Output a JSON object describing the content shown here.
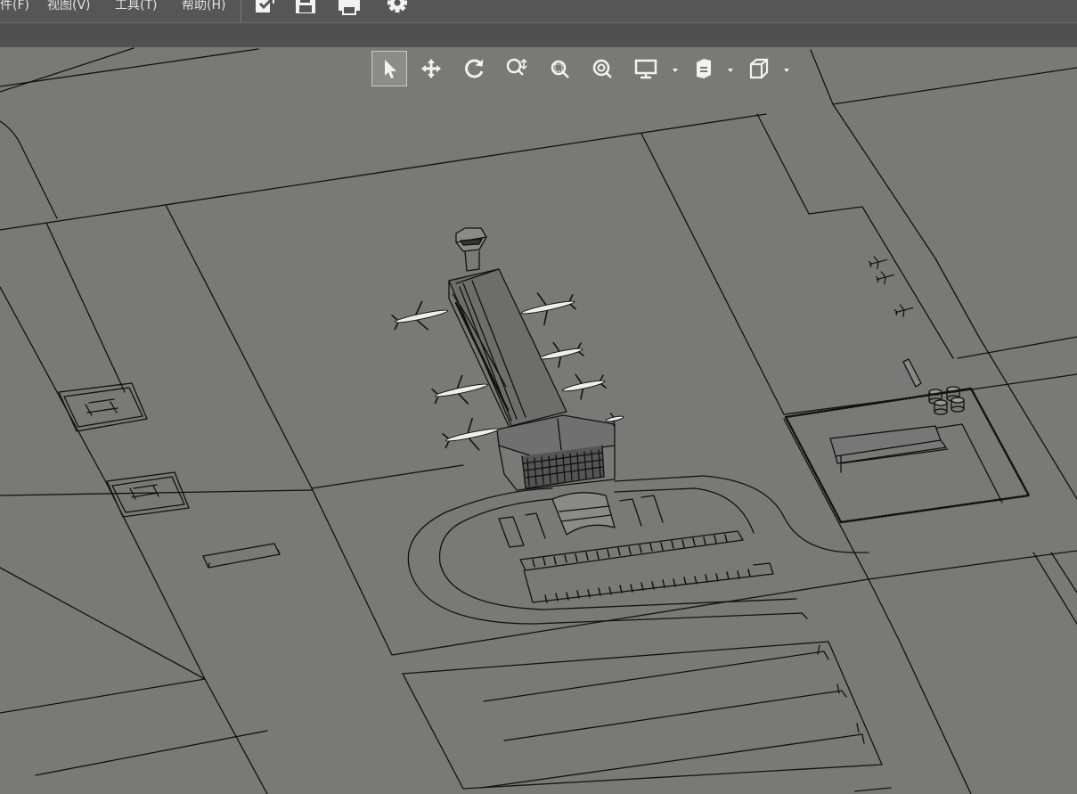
{
  "menu": {
    "items": [
      {
        "id": "file",
        "label": "件(F)"
      },
      {
        "id": "view",
        "label": "视图(V)"
      },
      {
        "id": "tools",
        "label": "工具(T)"
      },
      {
        "id": "help",
        "label": "帮助(H)"
      }
    ],
    "toolbar_icons": [
      "open-file-icon",
      "save-icon",
      "print-icon",
      "settings-gear-icon"
    ]
  },
  "viewport_toolbar": {
    "tools": [
      {
        "icon": "select-arrow-icon",
        "active": true
      },
      {
        "icon": "pan-move-icon",
        "active": false
      },
      {
        "icon": "orbit-rotate-icon",
        "active": false
      },
      {
        "icon": "zoom-icon",
        "active": false
      },
      {
        "icon": "zoom-window-icon",
        "active": false
      },
      {
        "icon": "zoom-extents-icon",
        "active": false
      },
      {
        "icon": "display-mode-icon",
        "dropdown": true
      },
      {
        "icon": "render-style-icon",
        "dropdown": true
      },
      {
        "icon": "view-cube-icon",
        "dropdown": true
      }
    ]
  },
  "colors": {
    "menubar_bg": "#565656",
    "subbar_bg": "#505050",
    "viewport_bg": "#797975",
    "linework": "#111111",
    "icon": "#f2f2f2"
  }
}
